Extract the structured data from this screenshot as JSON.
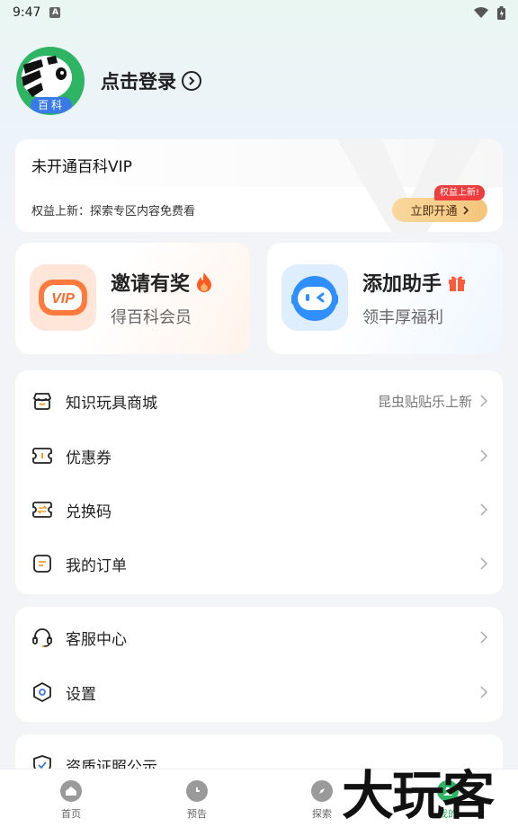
{
  "status_bar": {
    "time": "9:47",
    "notif_badge": "A"
  },
  "profile": {
    "avatar_badge": "百科",
    "login_label": "点击登录"
  },
  "vip": {
    "title": "未开通百科VIP",
    "description": "权益上新：探索专区内容免费看",
    "open_button": "立即开通",
    "new_tag": "权益上新!"
  },
  "promos": [
    {
      "title": "邀请有奖",
      "subtitle": "得百科会员",
      "icon_text": "VIP"
    },
    {
      "title": "添加助手",
      "subtitle": "领丰厚福利"
    }
  ],
  "menu_group_1": [
    {
      "label": "知识玩具商城",
      "extra": "昆虫贴贴乐上新",
      "icon": "shop-icon"
    },
    {
      "label": "优惠券",
      "icon": "coupon-icon"
    },
    {
      "label": "兑换码",
      "icon": "exchange-icon"
    },
    {
      "label": "我的订单",
      "icon": "order-icon"
    }
  ],
  "menu_group_2": [
    {
      "label": "客服中心",
      "icon": "headset-icon"
    },
    {
      "label": "设置",
      "icon": "settings-icon"
    }
  ],
  "menu_group_3": [
    {
      "label": "资质证照公示",
      "icon": "shield-icon"
    }
  ],
  "bottom_nav": [
    {
      "label": "首页",
      "active": false
    },
    {
      "label": "预告",
      "active": false
    },
    {
      "label": "探索",
      "active": false
    },
    {
      "label": "我的",
      "active": true
    }
  ],
  "watermark": "大玩客",
  "colors": {
    "brand_green": "#2db563",
    "vip_gold": "#f4c57b",
    "alert_red": "#ef3c3c"
  }
}
